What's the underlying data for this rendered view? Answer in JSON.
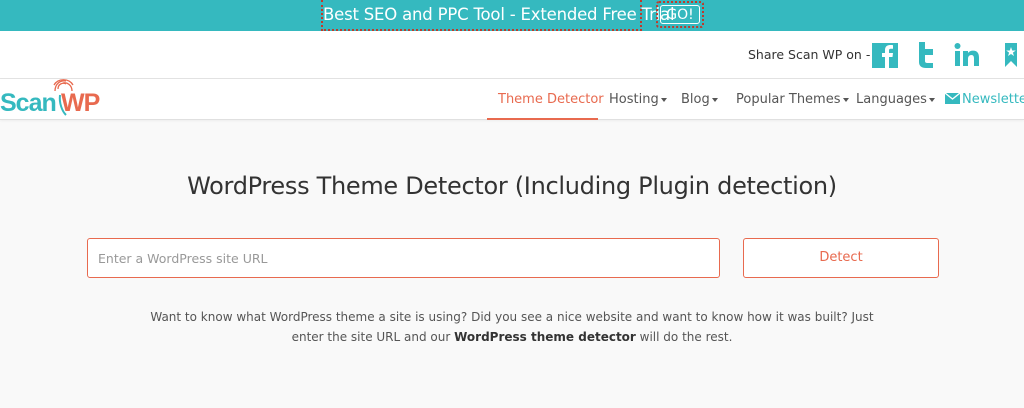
{
  "promo": {
    "text": "Best SEO and PPC Tool - Extended Free Trial",
    "go_label": "GO!"
  },
  "share": {
    "label": "Share Scan WP on -",
    "icons": [
      "facebook-icon",
      "twitter-icon",
      "linkedin-icon",
      "bookmark-icon"
    ]
  },
  "logo": {
    "text_part1": "Scan",
    "text_part2": "WP"
  },
  "nav": {
    "items": [
      {
        "label": "Theme Detector",
        "active": true
      },
      {
        "label": "Hosting"
      },
      {
        "label": "Blog"
      },
      {
        "label": "Popular Themes"
      },
      {
        "label": "Languages"
      }
    ],
    "newsletter": "Newsletter"
  },
  "main": {
    "title": "WordPress Theme Detector (Including Plugin detection)",
    "input_placeholder": "Enter a WordPress site URL",
    "detect_label": "Detect",
    "desc_part1": "Want to know what WordPress theme a site is using? Did you see a nice website and want to know how it was built? Just enter the site URL and our ",
    "desc_bold": "WordPress theme detector",
    "desc_part2": " will do the rest."
  },
  "colors": {
    "teal": "#35b9bf",
    "accent": "#e86a4f"
  }
}
